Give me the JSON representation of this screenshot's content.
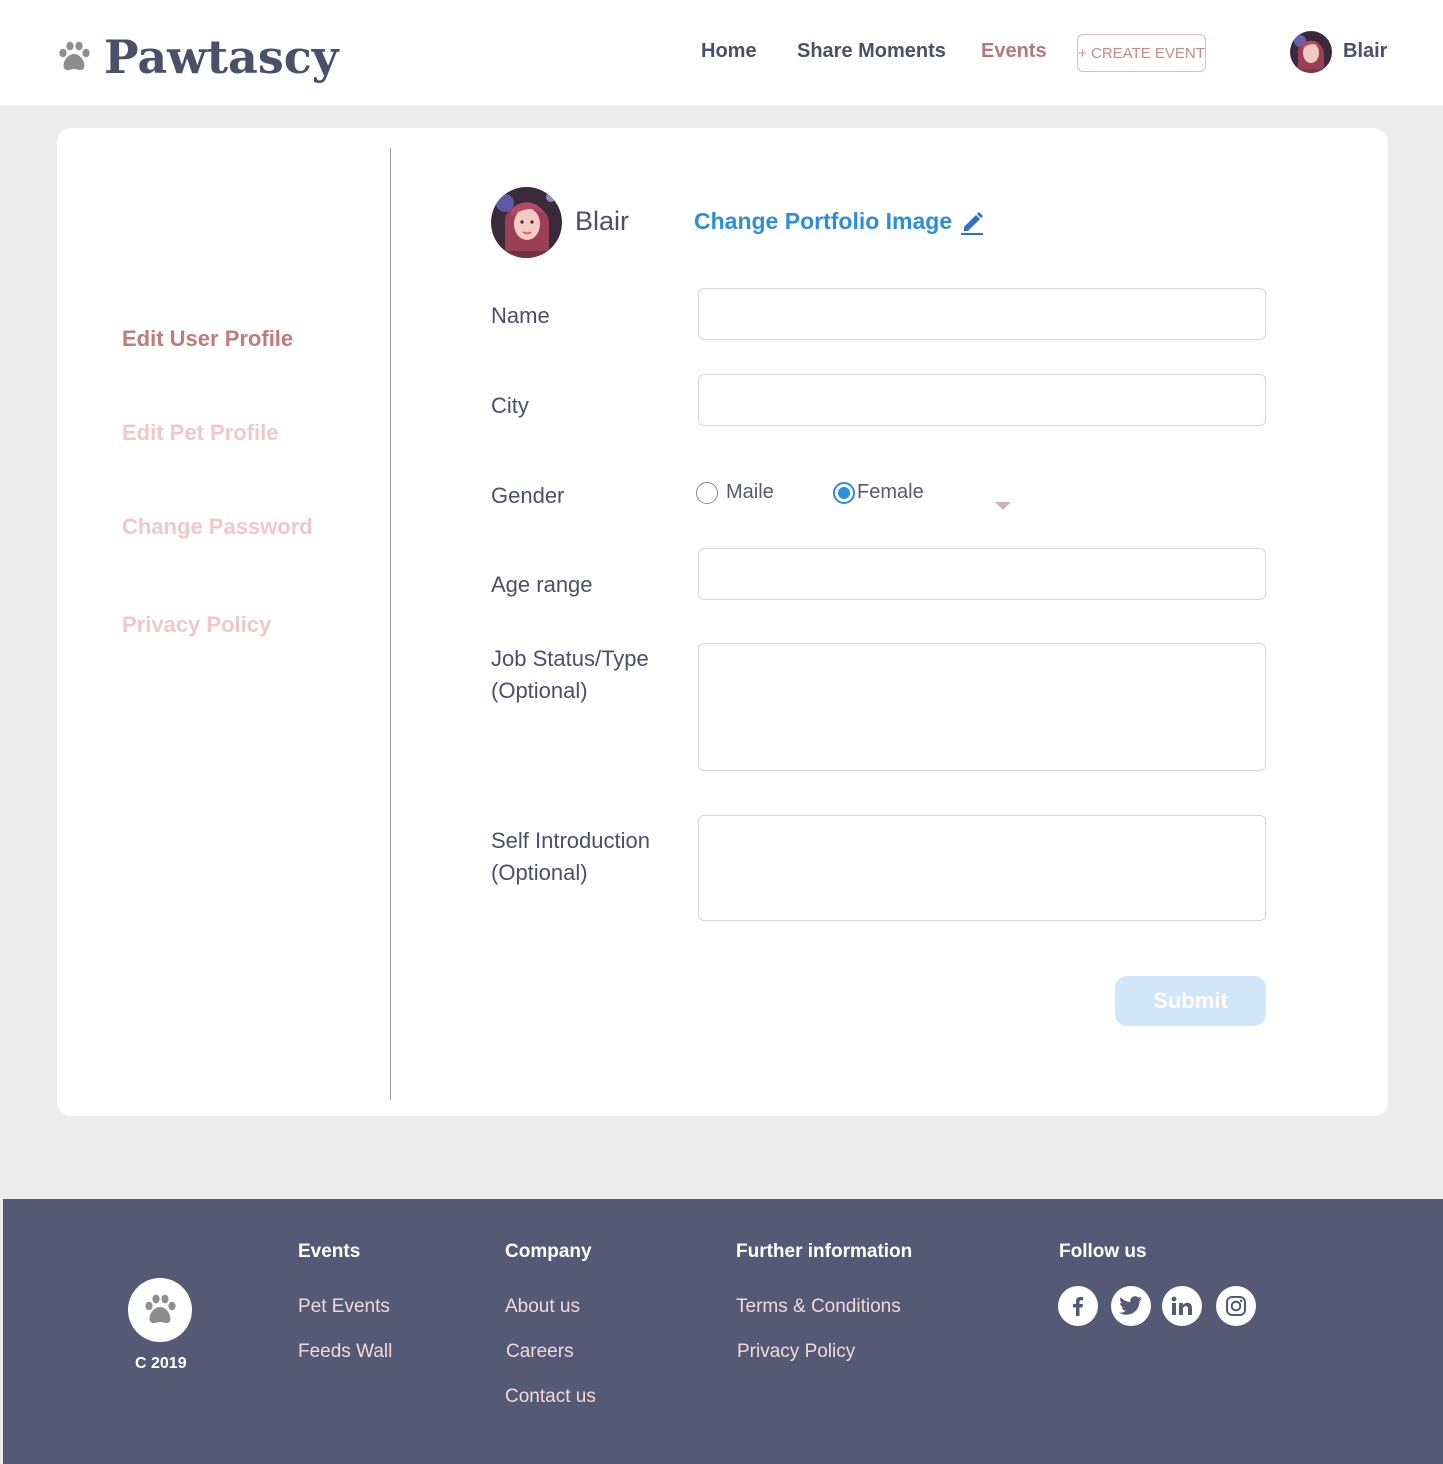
{
  "brand": {
    "name": "Pawtascy"
  },
  "nav": {
    "items": [
      {
        "label": "Home",
        "active": false
      },
      {
        "label": "Share Moments",
        "active": false
      },
      {
        "label": "Events",
        "active": true
      }
    ],
    "create_event": "+ CREATE EVENT",
    "user_name": "Blair"
  },
  "sidebar": {
    "items": [
      {
        "label": "Edit User Profile",
        "color": "#c27a7a"
      },
      {
        "label": "Edit Pet Profile",
        "color": "#f0c8c8"
      },
      {
        "label": "Change Password",
        "color": "#f0c8c8"
      },
      {
        "label": "Privacy Policy",
        "color": "#f0c8c8"
      }
    ]
  },
  "profile": {
    "name": "Blair",
    "change_image": "Change Portfolio Image"
  },
  "form": {
    "name_label": "Name",
    "name_value": "",
    "city_label": "City",
    "city_value": "",
    "gender_label": "Gender",
    "gender_options": [
      "Maile",
      "Female"
    ],
    "gender_selected": "Female",
    "age_label": "Age range",
    "age_value": "",
    "job_label_1": "Job Status/Type",
    "job_label_2": "(Optional)",
    "job_value": "",
    "intro_label_1": "Self Introduction",
    "intro_label_2": "(Optional)",
    "intro_value": "",
    "submit": "Submit"
  },
  "footer": {
    "copyright": "C 2019",
    "columns": [
      {
        "heading": "Events",
        "links": [
          "Pet Events",
          "Feeds Wall"
        ]
      },
      {
        "heading": "Company",
        "links": [
          "About us",
          "Careers",
          "Contact us"
        ]
      },
      {
        "heading": "Further information",
        "links": [
          "Terms & Conditions",
          "Privacy Policy"
        ]
      },
      {
        "heading": "Follow us",
        "links": []
      }
    ],
    "social_icons": [
      "facebook-icon",
      "twitter-icon",
      "linkedin-icon",
      "instagram-icon"
    ]
  },
  "colors": {
    "brand_dark": "#4a4f6a",
    "accent_pink": "#b87878",
    "link_blue": "#2c8ee0",
    "footer_bg": "#545a75"
  }
}
